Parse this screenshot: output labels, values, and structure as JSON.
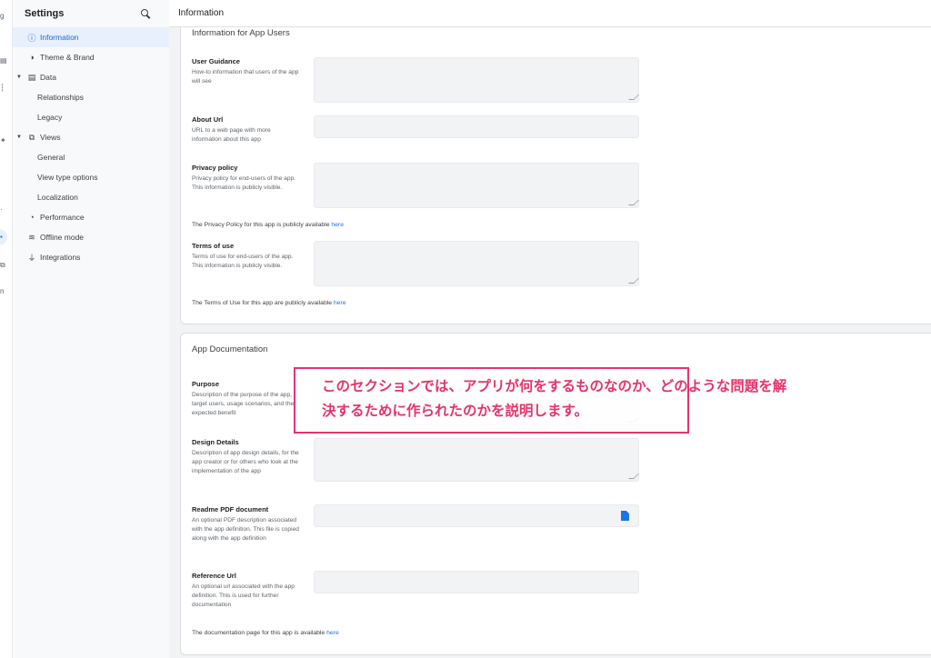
{
  "sidebar": {
    "title": "Settings",
    "items": [
      {
        "label": "Information",
        "icon": "info-icon",
        "glyph": "ⓘ"
      },
      {
        "label": "Theme & Brand",
        "icon": "palette-icon",
        "glyph": "◑"
      },
      {
        "label": "Data",
        "icon": "table-icon",
        "glyph": "▤"
      },
      {
        "label": "Relationships"
      },
      {
        "label": "Legacy"
      },
      {
        "label": "Views",
        "icon": "views-icon",
        "glyph": "⧉"
      },
      {
        "label": "General"
      },
      {
        "label": "View type options"
      },
      {
        "label": "Localization"
      },
      {
        "label": "Performance",
        "icon": "gauge-icon",
        "glyph": "◔"
      },
      {
        "label": "Offline mode",
        "icon": "wifi-off-icon",
        "glyph": "≋"
      },
      {
        "label": "Integrations",
        "icon": "plug-icon",
        "glyph": "⏚"
      }
    ]
  },
  "header": {
    "title": "Information"
  },
  "section1": {
    "title": "Information for App Users",
    "fields": [
      {
        "label": "User Guidance",
        "desc": "How-to information that users of the app will see"
      },
      {
        "label": "About Url",
        "desc": "URL to a web page with more information about this app"
      },
      {
        "label": "Privacy policy",
        "desc": "Privacy policy for end-users of the app. This information is publicly visible."
      },
      {
        "label": "Terms of use",
        "desc": "Terms of use for end-users of the app. This information is publicly visible."
      }
    ],
    "privacy_note": "The Privacy Policy for this app is publicly available ",
    "terms_note": "The Terms of Use for this app are publicly available ",
    "link": "here"
  },
  "section2": {
    "title": "App Documentation",
    "fields": [
      {
        "label": "Purpose",
        "desc": "Description of the purpose of the app, target users, usage scenarios, and the expected benefit"
      },
      {
        "label": "Design Details",
        "desc": "Description of app design details, for the app creator or for others who look at the implementation of the app"
      },
      {
        "label": "Readme PDF document",
        "desc": "An optional PDF description associated with the app definition. This file is copied along with the app definition"
      },
      {
        "label": "Reference Url",
        "desc": "An optional url associated with the app definition. This is used for further documentation"
      }
    ],
    "doc_note": "The documentation page for this app is available ",
    "link": "here"
  },
  "callout": {
    "text": "このセクションでは、アプリが何をするものなのか、どのような問題を解\n決するために作られたのかを説明します。",
    "color": "#e8336a"
  }
}
